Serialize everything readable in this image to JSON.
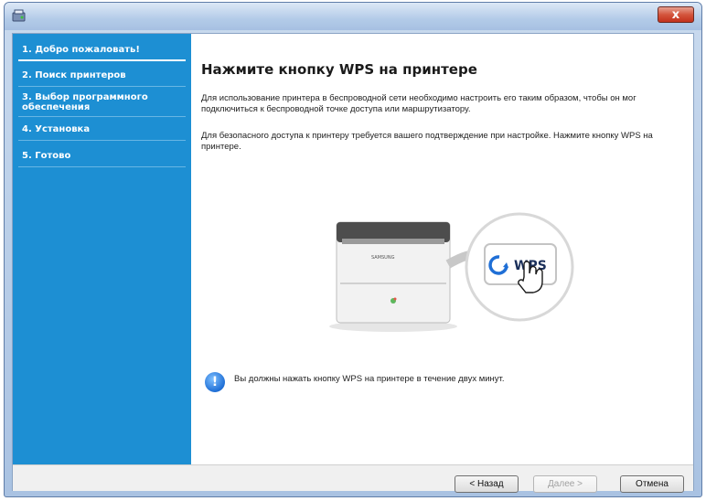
{
  "window": {
    "close_label": "x"
  },
  "sidebar": {
    "items": [
      {
        "label": "1. Добро пожаловать!",
        "active": true
      },
      {
        "label": "2. Поиск принтеров",
        "active": false
      },
      {
        "label": "3. Выбор программного обеспечения",
        "active": false
      },
      {
        "label": "4. Установка",
        "active": false
      },
      {
        "label": "5. Готово",
        "active": false
      }
    ]
  },
  "main": {
    "title": "Нажмите кнопку WPS на принтере",
    "paragraph1": "Для использование принтера в беспроводной сети необходимо настроить его таким образом, чтобы он мог подключиться к беспроводной точке доступа или маршрутизатору.",
    "paragraph2": "Для безопасного доступа к принтеру требуется вашего подтверждение при настройке. Нажмите кнопку WPS на принтере.",
    "illustration": {
      "brand": "SAMSUNG",
      "wps_label": "WPS"
    },
    "info_text": "Вы должны нажать кнопку WPS на принтере в течение двух минут."
  },
  "footer": {
    "back_label": "< Назад",
    "next_label": "Далее >",
    "cancel_label": "Отмена"
  },
  "colors": {
    "sidebar": "#1d8fd3",
    "accent": "#1f6fd6"
  },
  "icons": [
    "app-icon",
    "close-icon",
    "info-icon",
    "wps-icon",
    "hand-cursor-icon"
  ]
}
